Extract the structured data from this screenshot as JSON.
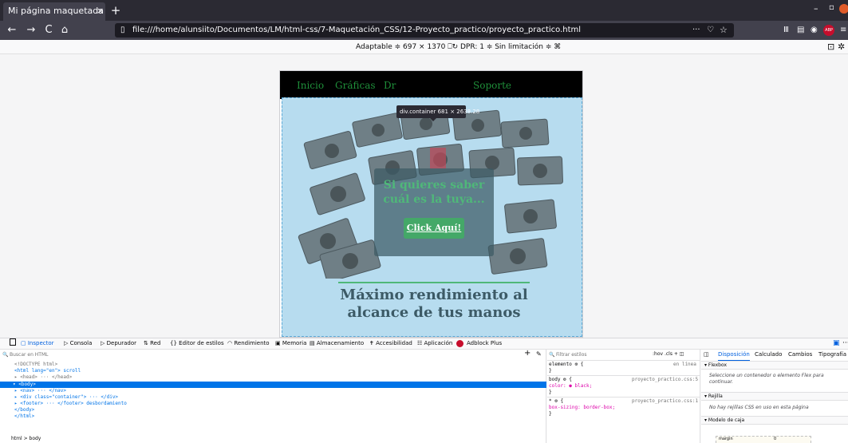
{
  "browser": {
    "tab_title": "Mi página maquetada con C",
    "tab_close": "×",
    "new_tab": "+",
    "window_min": "–",
    "window_max": "▫",
    "url": "file:///home/alunsiito/Documentos/LM/html-css/7-Maquetación_CSS/12-Proyecto_practico/proyecto_practico.html",
    "more": "···",
    "back": "←",
    "forward": "→",
    "reload": "C",
    "home": "⌂",
    "library": "Ⅲ",
    "sidebar": "▤",
    "account": "◉",
    "abp": "ABP",
    "menu": "≡",
    "pocket": "♡",
    "bookmark": "☆",
    "page_icon": "▯"
  },
  "rdm": {
    "toolbar_text": "Adaptable ≑   697  ×  1370   ⎕↻    DPR: 1  ≑   Sin limitación ≑   ⌘",
    "screenshot": "⊡",
    "settings": "✲"
  },
  "site": {
    "nav_links": [
      "Inicio",
      "Gráficas",
      "Dr",
      "Soporte"
    ],
    "tooltip_text": "div.container  681 × 2638.28",
    "overlay_text": "Si quieres saber cuál es la tuya...",
    "overlay_button": "Click Aquí!",
    "headline": "Máximo rendimiento al alcance de tus manos"
  },
  "devtools": {
    "tabs": [
      "Inspector",
      "Consola",
      "Depurador",
      "Red",
      "Editor de estilos",
      "Rendimiento",
      "Memoria",
      "Almacenamiento",
      "Accesibilidad",
      "Aplicación",
      "Adblock Plus"
    ],
    "tab_icons": [
      "▢",
      "▷",
      "⇅",
      "{}",
      "◠",
      "▣",
      "▤",
      "✝",
      "☷"
    ],
    "dock": "▣",
    "more": "···",
    "search_placeholder": "Buscar en HTML",
    "search_icon": "🔍",
    "add": "+",
    "pick": "✎",
    "tree": [
      "<!DOCTYPE html>",
      "<html lang=\"en\"> scroll",
      "▸ <head> ··· </head>",
      "▾ <body>",
      "  ▸ <nav> ··· </nav>",
      "  ▸ <div class=\"container\"> ··· </div>",
      "  ▸ <footer> ··· </footer>  desbordamiento",
      "  </body>",
      "</html>"
    ],
    "breadcrumb": "html > body",
    "filter_placeholder": "Filtrar estilos",
    "hov_cls": ":hov  .cls   +   ◫",
    "rules": {
      "r1_selector": "elemento ⚙ {",
      "r1_source": "en línea",
      "r1_close": "}",
      "r2_selector": "body ⚙ {",
      "r2_source": "proyecto_practico.css:5",
      "r2_prop": "  color: ● black;",
      "r2_close": "}",
      "r3_selector": "* ⚙ {",
      "r3_source": "proyecto_practico.css:1",
      "r3_prop": "  box-sizing: border-box;",
      "r3_close": "}"
    },
    "layout_tabs": [
      "Disposición",
      "Calculado",
      "Cambios",
      "Tipografía"
    ],
    "layout_icon": "◫",
    "flexbox_head": "▾ Flexbox",
    "flexbox_note": "Seleccione un contenedor o elemento Flex para continuar.",
    "rejilla_head": "▾ Rejilla",
    "rejilla_note": "No hay rejillas CSS en uso en esta página",
    "boxmodel_head": "▾ Modelo de caja",
    "boxmodel_label": "margin",
    "boxmodel_value": "0"
  },
  "colors": {
    "tab_bar": "#2b2a33",
    "nav_link": "#1f8f3a",
    "highlight": "#b7dcef",
    "overlay_text": "#4fb879",
    "headline": "#3c5a66",
    "selection": "#0074e8",
    "accent": "#0060df"
  }
}
